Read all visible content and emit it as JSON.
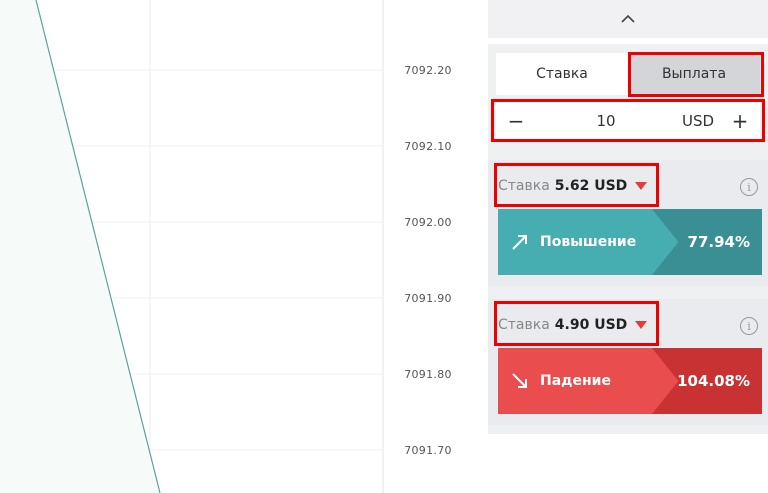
{
  "chart": {
    "price_labels": [
      "7092.20",
      "7092.10",
      "7092.00",
      "7091.90",
      "7091.80",
      "7091.70"
    ]
  },
  "panel": {
    "collapse_icon": "chevron-up-icon",
    "mode_tabs": [
      {
        "label": "Ставка",
        "active": false
      },
      {
        "label": "Выплата",
        "active": true
      }
    ],
    "amount": {
      "minus": "−",
      "value": "10",
      "currency": "USD",
      "plus": "+"
    },
    "up": {
      "stake_label": "Ставка",
      "stake_value": "5.62 USD",
      "button_label": "Повышение",
      "percent": "77.94%",
      "icon": "arrow-up-right-icon",
      "color": "#46adb1"
    },
    "down": {
      "stake_label": "Ставка",
      "stake_value": "4.90 USD",
      "button_label": "Падение",
      "percent": "104.08%",
      "icon": "arrow-down-right-icon",
      "color": "#e94d4d"
    },
    "highlight_color": "#ee0000"
  }
}
